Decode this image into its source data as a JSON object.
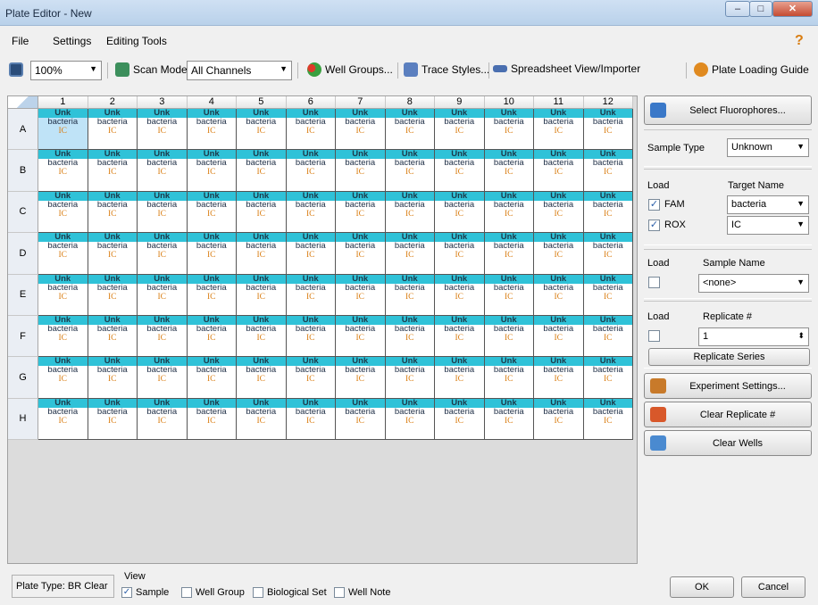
{
  "window": {
    "title": "Plate Editor - New",
    "minimize": "–",
    "maximize": "□",
    "close": "✕"
  },
  "menu": [
    "File",
    "Settings",
    "Editing Tools"
  ],
  "help": "?",
  "toolbar": {
    "zoom": "100%",
    "scan_mode_label": "Scan Mode",
    "scan_mode_value": "All Channels",
    "well_groups": "Well Groups...",
    "trace_styles": "Trace Styles...",
    "spreadsheet": "Spreadsheet View/Importer",
    "plate_loading_guide": "Plate Loading Guide"
  },
  "plate": {
    "columns": [
      "1",
      "2",
      "3",
      "4",
      "5",
      "6",
      "7",
      "8",
      "9",
      "10",
      "11",
      "12"
    ],
    "rows": [
      "A",
      "B",
      "C",
      "D",
      "E",
      "F",
      "G",
      "H"
    ],
    "well": {
      "type": "Unk",
      "target1": "bacteria",
      "target2": "IC"
    },
    "selected_well": "A1"
  },
  "right_panel": {
    "select_fluorophores": "Select Fluorophores...",
    "sample_type_label": "Sample Type",
    "sample_type_value": "Unknown",
    "load_label": "Load",
    "target_name_label": "Target Name",
    "targets": [
      {
        "fluor": "FAM",
        "checked": "✓",
        "name": "bacteria"
      },
      {
        "fluor": "ROX",
        "checked": "✓",
        "name": "IC"
      }
    ],
    "sample_load_label": "Load",
    "sample_name_label": "Sample Name",
    "sample_name_value": "<none>",
    "replicate_load_label": "Load",
    "replicate_label": "Replicate #",
    "replicate_value": "1",
    "replicate_series": "Replicate Series",
    "experiment_settings": "Experiment Settings...",
    "clear_replicate": "Clear Replicate #",
    "clear_wells": "Clear Wells"
  },
  "bottom": {
    "plate_type": "Plate Type: BR Clear",
    "view_label": "View",
    "view_options": [
      {
        "label": "Sample",
        "checked": "✓"
      },
      {
        "label": "Well Group",
        "checked": ""
      },
      {
        "label": "Biological Set",
        "checked": ""
      },
      {
        "label": "Well Note",
        "checked": ""
      }
    ],
    "ok": "OK",
    "cancel": "Cancel"
  },
  "colors": {
    "well_type_band": "#2fc2d8",
    "ic_text": "#d97d12",
    "selected_well": "#bfe3f7"
  },
  "icons": [
    "save-icon",
    "scan-mode-icon",
    "well-groups-icon",
    "trace-styles-icon",
    "spreadsheet-icon",
    "plate-loading-guide-icon",
    "select-fluorophores-icon",
    "experiment-settings-icon",
    "clear-replicate-icon",
    "clear-wells-icon"
  ]
}
